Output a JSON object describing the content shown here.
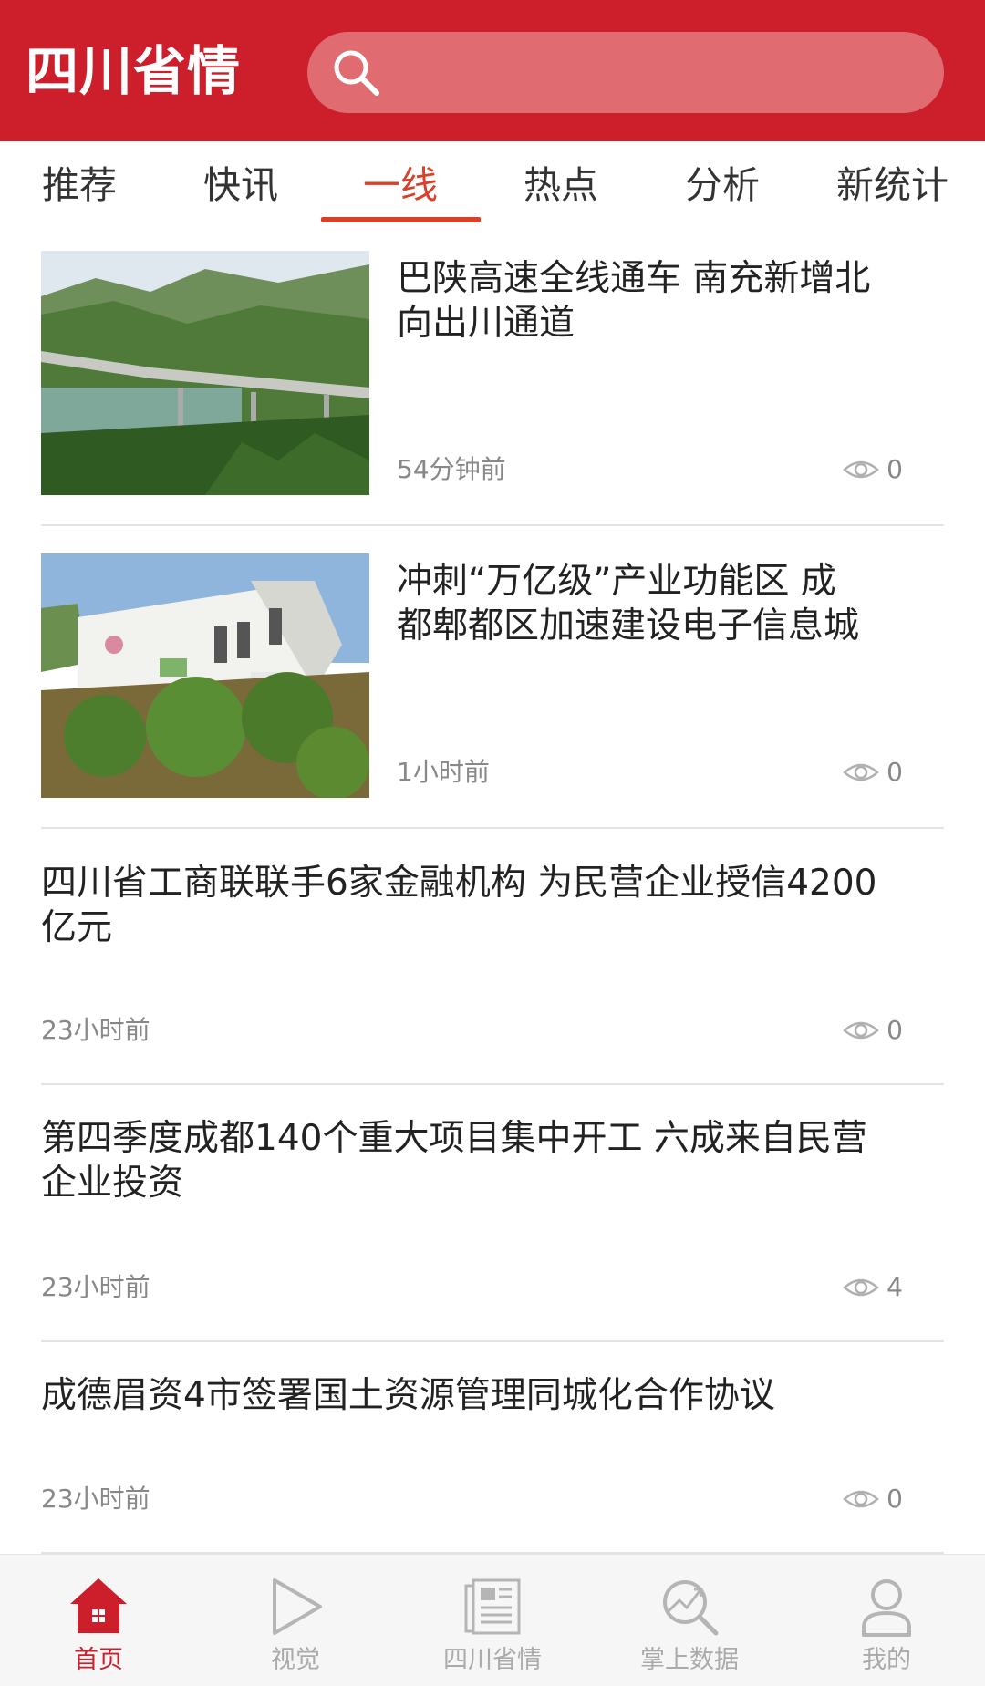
{
  "header": {
    "logo_text": "四川省情",
    "search_placeholder": ""
  },
  "tabs": [
    {
      "label": "推荐"
    },
    {
      "label": "快讯"
    },
    {
      "label": "一线",
      "active": true
    },
    {
      "label": "热点"
    },
    {
      "label": "分析"
    },
    {
      "label": "新统计"
    }
  ],
  "articles": [
    {
      "title": "巴陕高速全线通车 南充新增北向出川通道",
      "time": "54分钟前",
      "views": "0",
      "has_image": true
    },
    {
      "title": "冲刺“万亿级”产业功能区 成都郫都区加速建设电子信息城",
      "time": "1小时前",
      "views": "0",
      "has_image": true
    },
    {
      "title": "四川省工商联联手6家金融机构 为民营企业授信4200亿元",
      "time": "23小时前",
      "views": "0",
      "has_image": false
    },
    {
      "title": "第四季度成都140个重大项目集中开工 六成来自民营企业投资",
      "time": "23小时前",
      "views": "4",
      "has_image": false
    },
    {
      "title": "成德眉资4市签署国土资源管理同城化合作协议",
      "time": "23小时前",
      "views": "0",
      "has_image": false
    }
  ],
  "bottom_nav": [
    {
      "label": "首页",
      "icon": "home-icon",
      "active": true
    },
    {
      "label": "视觉",
      "icon": "play-icon"
    },
    {
      "label": "四川省情",
      "icon": "newspaper-icon"
    },
    {
      "label": "掌上数据",
      "icon": "chart-search-icon"
    },
    {
      "label": "我的",
      "icon": "user-icon"
    }
  ],
  "colors": {
    "brand_red": "#cc1f2b",
    "tab_active": "#d8402a",
    "muted": "#888888"
  }
}
